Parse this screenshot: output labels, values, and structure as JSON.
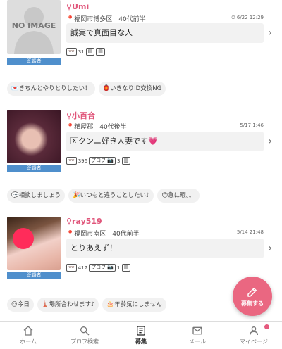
{
  "posts": [
    {
      "name": "♀Umi",
      "location": "福岡市博多区　40代前半",
      "date": "6/22 12:29",
      "message": "誠実で真面目な人",
      "status": "既婚者",
      "photo_label": "NO IMAGE",
      "photo_count": "31",
      "tags": [
        "💌きちんとやりとりしたい！",
        "🏮いきなりID交換NG"
      ]
    },
    {
      "name": "♀小百合",
      "location": "糟屋郡　40代後半",
      "date": "5/17 1:46",
      "message": "🅇クンニ好き人妻です💗",
      "status": "既婚者",
      "photo_count": "396",
      "profile_label": "プロフ",
      "profile_count": "3",
      "tags": [
        "💬相談しましょう",
        "🎉いつもと違うことしたい♪",
        "😊急に暇。。"
      ]
    },
    {
      "name": "♀ray519",
      "location": "福岡市南区　40代前半",
      "date": "5/14 21:48",
      "message": "とりあえず！",
      "status": "既婚者",
      "photo_count": "417",
      "profile_label": "プロフ",
      "profile_count": "1",
      "tags": [
        "😍今日",
        "🗼場所合わせます♪",
        "🎂年齢気にしません"
      ]
    }
  ],
  "fab_label": "募集する",
  "tabs": [
    {
      "label": "ホーム"
    },
    {
      "label": "プロフ検索"
    },
    {
      "label": "募集"
    },
    {
      "label": "メール"
    },
    {
      "label": "マイページ"
    }
  ],
  "colors": {
    "accent": "#e0557a",
    "status": "#4f8fcc",
    "fab": "#ea6781"
  }
}
